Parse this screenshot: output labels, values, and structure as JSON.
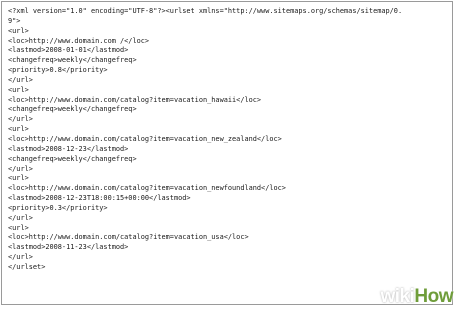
{
  "document": {
    "lines": [
      "<?xml version=\"1.0\" encoding=\"UTF-8\"?><urlset xmlns=\"http://www.sitemaps.org/schemas/sitemap/0.",
      "9\">",
      "<url>",
      "<loc>http://www.domain.com /</loc>",
      "<lastmod>2008-01-01</lastmod>",
      "<changefreq>weekly</changefreq>",
      "<priority>0.8</priority>",
      "</url>",
      "<url>",
      "<loc>http://www.domain.com/catalog?item=vacation_hawaii</loc>",
      "<changefreq>weekly</changefreq>",
      "</url>",
      "<url>",
      "<loc>http://www.domain.com/catalog?item=vacation_new_zealand</loc>",
      "<lastmod>2008-12-23</lastmod>",
      "<changefreq>weekly</changefreq>",
      "</url>",
      "<url>",
      "<loc>http://www.domain.com/catalog?item=vacation_newfoundland</loc>",
      "<lastmod>2008-12-23T18:00:15+00:00</lastmod>",
      "<priority>0.3</priority>",
      "</url>",
      "<url>",
      "<loc>http://www.domain.com/catalog?item=vacation_usa</loc>",
      "<lastmod>2008-11-23</lastmod>",
      "</url>",
      "</urlset>"
    ]
  },
  "watermark": {
    "part1": "wiki",
    "part2": "How"
  },
  "colors": {
    "text": "#1a1a1a",
    "border": "#9a9a9a",
    "watermark_green": "#6f9d3a"
  }
}
